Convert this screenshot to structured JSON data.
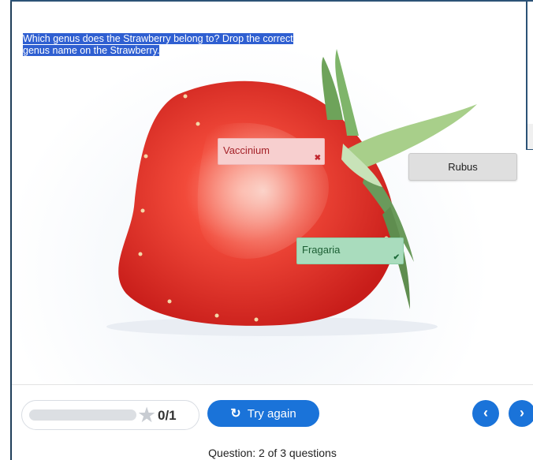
{
  "question": {
    "text": "Which genus does the Strawberry belong to? Drop the correct genus name on the Strawberry."
  },
  "image": {
    "alt": "Strawberry"
  },
  "dropzones": [
    {
      "label": "Vaccinium",
      "status": "incorrect",
      "mark": "✖"
    },
    {
      "label": "Fragaria",
      "status": "correct",
      "mark": "✔"
    }
  ],
  "draggables": [
    {
      "label": "Rubus"
    }
  ],
  "footer": {
    "score": "0/1",
    "try_again_label": "Try again",
    "try_again_icon": "refresh-icon",
    "prev_icon": "chevron-left-icon",
    "next_icon": "chevron-right-icon",
    "progress_text": "Question: 2 of 3 questions"
  },
  "colors": {
    "accent": "#1a73d9",
    "incorrect_bg": "#f7cfcf",
    "correct_bg": "#a9dcbd",
    "selection": "#2f5fd1"
  }
}
